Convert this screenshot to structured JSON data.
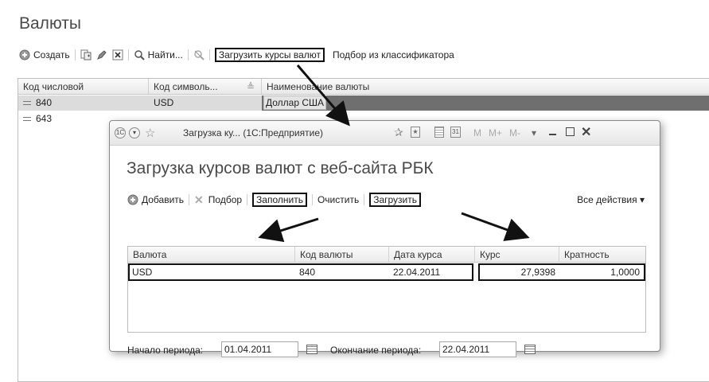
{
  "main": {
    "title": "Валюты",
    "toolbar": {
      "create": "Создать",
      "find": "Найти...",
      "load_rates": "Загрузить курсы валют",
      "pick_classifier": "Подбор из классификатора"
    },
    "grid": {
      "columns": [
        "Код числовой",
        "Код символь...",
        "Наименование валюты"
      ],
      "rows": [
        {
          "num": "840",
          "sym": "USD",
          "name": "Доллар США"
        },
        {
          "num": "643",
          "sym": "",
          "name": ""
        }
      ]
    }
  },
  "dialog": {
    "window_title": "Загрузка ку... (1С:Предприятие)",
    "titlebar_icons": [
      "M",
      "M+",
      "M-"
    ],
    "heading": "Загрузка курсов валют с веб-сайта РБК",
    "toolbar": {
      "add": "Добавить",
      "pick": "Подбор",
      "fill": "Заполнить",
      "clear": "Очистить",
      "load": "Загрузить",
      "all_actions": "Все действия ▾"
    },
    "grid": {
      "columns": [
        "Валюта",
        "Код валюты",
        "Дата курса",
        "Курс",
        "Кратность"
      ],
      "row": {
        "currency": "USD",
        "code": "840",
        "date": "22.04.2011",
        "rate": "27,9398",
        "multiplicity": "1,0000"
      }
    },
    "period": {
      "start_label": "Начало периода:",
      "start_value": "01.04.2011",
      "end_label": "Окончание периода:",
      "end_value": "22.04.2011"
    }
  },
  "colors": {
    "selected_row": "#6f6f6f",
    "selected_cell": "#e4e4e4"
  }
}
